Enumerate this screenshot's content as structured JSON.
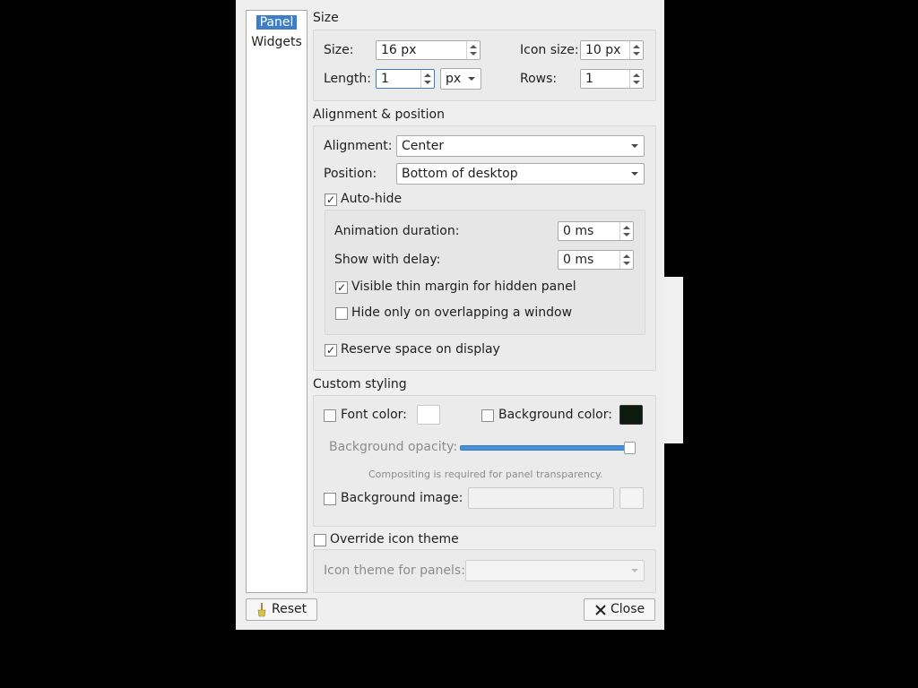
{
  "sidebar": {
    "items": [
      {
        "label": "Panel",
        "selected": true
      },
      {
        "label": "Widgets",
        "selected": false
      }
    ]
  },
  "size": {
    "title": "Size",
    "size_label": "Size:",
    "size_value": "16 px",
    "icon_size_label": "Icon size:",
    "icon_size_value": "10 px",
    "length_label": "Length:",
    "length_value": "1",
    "length_unit": "px",
    "rows_label": "Rows:",
    "rows_value": "1"
  },
  "alignment": {
    "title": "Alignment & position",
    "alignment_label": "Alignment:",
    "alignment_value": "Center",
    "position_label": "Position:",
    "position_value": "Bottom of desktop",
    "autohide_label": "Auto-hide",
    "autohide_checked": true,
    "anim_label": "Animation duration:",
    "anim_value": "0 ms",
    "delay_label": "Show with delay:",
    "delay_value": "0 ms",
    "thin_margin_label": "Visible thin margin for hidden panel",
    "thin_margin_checked": true,
    "overlap_label": "Hide only on overlapping a window",
    "overlap_checked": false,
    "reserve_label": "Reserve space on display",
    "reserve_checked": true
  },
  "styling": {
    "title": "Custom styling",
    "font_color_label": "Font color:",
    "font_color_checked": false,
    "font_color": "#ffffff",
    "bg_color_label": "Background color:",
    "bg_color_checked": false,
    "bg_color": "#0c1a10",
    "opacity_label": "Background opacity:",
    "opacity_value": 100,
    "compositing_note": "Compositing is required for panel transparency.",
    "bg_image_label": "Background image:",
    "bg_image_checked": false,
    "bg_image_value": ""
  },
  "icon_theme": {
    "override_label": "Override icon theme",
    "override_checked": false,
    "theme_label": "Icon theme for panels:",
    "theme_value": ""
  },
  "buttons": {
    "reset": "Reset",
    "close": "Close"
  },
  "colors": {
    "accent": "#3d7fc7",
    "slider": "#4a90d9"
  }
}
